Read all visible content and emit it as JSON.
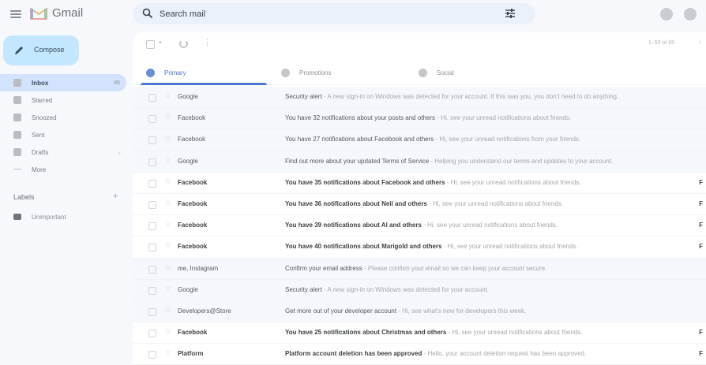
{
  "app": {
    "name": "Gmail"
  },
  "colors": {
    "accent": "#4a77d0",
    "compose_bg": "#c2e7ff",
    "active_nav": "#d3e3fd"
  },
  "search": {
    "placeholder": "Search mail"
  },
  "compose": {
    "label": "Compose"
  },
  "sidebar": {
    "items": [
      {
        "label": "Inbox",
        "count": "85",
        "icon": "inbox-icon"
      },
      {
        "label": "Starred",
        "icon": "star-icon"
      },
      {
        "label": "Snoozed",
        "icon": "clock-icon"
      },
      {
        "label": "Sent",
        "icon": "send-icon"
      },
      {
        "label": "Drafts",
        "icon": "draft-icon"
      },
      {
        "label": "More",
        "icon": "chevron-down-icon"
      }
    ]
  },
  "labels": {
    "title": "Labels",
    "items": [
      {
        "label": "Unimportant"
      }
    ]
  },
  "toolbar": {
    "pager": "1–50 of 85"
  },
  "tabs": [
    {
      "label": "Primary",
      "icon": "inbox-icon"
    },
    {
      "label": "Promotions",
      "icon": "tag-icon"
    },
    {
      "label": "Social",
      "icon": "people-icon"
    }
  ],
  "emails": [
    {
      "sender": "Google",
      "subject": "Security alert",
      "snippet": "A new sign-in on Windows was detected for your account. If this was you, you don't need to do anything.",
      "date": "",
      "unread": false
    },
    {
      "sender": "Facebook",
      "subject": "You have 32 notifications about your posts and others",
      "snippet": "Hi, see your unread notifications about friends.",
      "date": "",
      "unread": false
    },
    {
      "sender": "Facebook",
      "subject": "You have 27 notifications about Facebook and others",
      "snippet": "Hi, see your unread notifications from your friends.",
      "date": "",
      "unread": false
    },
    {
      "sender": "Google",
      "subject": "Find out more about your updated Terms of Service",
      "snippet": "Helping you understand our terms and updates to your account.",
      "date": "",
      "unread": false
    },
    {
      "sender": "Facebook",
      "subject": "You have 35 notifications about Facebook and others",
      "snippet": "Hi, see your unread notifications about friends.",
      "date": "F",
      "unread": true
    },
    {
      "sender": "Facebook",
      "subject": "You have 36 notifications about Neil and others",
      "snippet": "Hi, see your unread notifications about friends.",
      "date": "F",
      "unread": true
    },
    {
      "sender": "Facebook",
      "subject": "You have 39 notifications about Al and others",
      "snippet": "Hi, see your unread notifications about friends.",
      "date": "F",
      "unread": true
    },
    {
      "sender": "Facebook",
      "subject": "You have 40 notifications about Marigold and others",
      "snippet": "Hi, see your unread notifications about friends.",
      "date": "F",
      "unread": true
    },
    {
      "sender": "me, Instagram",
      "subject": "Confirm your email address",
      "snippet": "Please confirm your email so we can keep your account secure.",
      "date": "",
      "unread": false
    },
    {
      "sender": "Google",
      "subject": "Security alert",
      "snippet": "A new sign-in on Windows was detected for your account.",
      "date": "",
      "unread": false
    },
    {
      "sender": "Developers@Store",
      "subject": "Get more out of your developer account",
      "snippet": "Hi, see what's new for developers this week.",
      "date": "",
      "unread": false
    },
    {
      "sender": "Facebook",
      "subject": "You have 25 notifications about Christmas and others",
      "snippet": "Hi, see your unread notifications about friends.",
      "date": "F",
      "unread": true
    },
    {
      "sender": "Platform",
      "subject": "Platform account deletion has been approved",
      "snippet": "Hello, your account deletion request has been approved.",
      "date": "F",
      "unread": true
    }
  ]
}
